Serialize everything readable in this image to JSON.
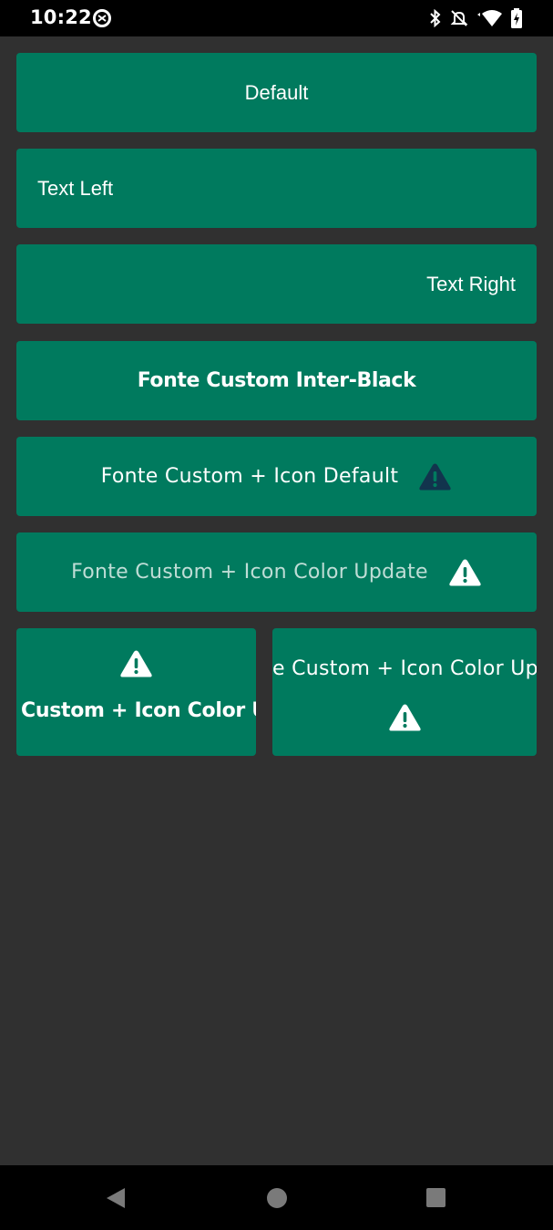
{
  "status_bar": {
    "time": "10:22",
    "left_icon": "data-saver-icon",
    "right_icons": [
      "bluetooth-icon",
      "notifications-off-icon",
      "wifi-icon",
      "battery-icon"
    ]
  },
  "buttons": {
    "default": {
      "label": "Default"
    },
    "text_left": {
      "label": "Text Left"
    },
    "text_right": {
      "label": "Text Right"
    },
    "custom_black": {
      "label": "Fonte Custom Inter-Black"
    },
    "icon_default": {
      "label": "Fonte Custom + Icon Default",
      "icon": "warning-icon",
      "icon_color": "#12344D"
    },
    "icon_color_update": {
      "label": "Fonte Custom + Icon Color Update",
      "icon": "warning-icon",
      "icon_color": "#FFFFFF"
    },
    "vertical_icon_top": {
      "label": "Custom + Icon Color U",
      "icon": "warning-icon",
      "icon_color": "#FFFFFF"
    },
    "vertical_icon_bottom": {
      "label": "e Custom + Icon Color Up",
      "icon": "warning-icon",
      "icon_color": "#FFFFFF"
    }
  },
  "colors": {
    "background": "#303030",
    "button": "#007A5E",
    "text": "#FFFFFF"
  },
  "navigation_bar": {
    "buttons": [
      "back-icon",
      "home-icon",
      "recents-icon"
    ]
  }
}
